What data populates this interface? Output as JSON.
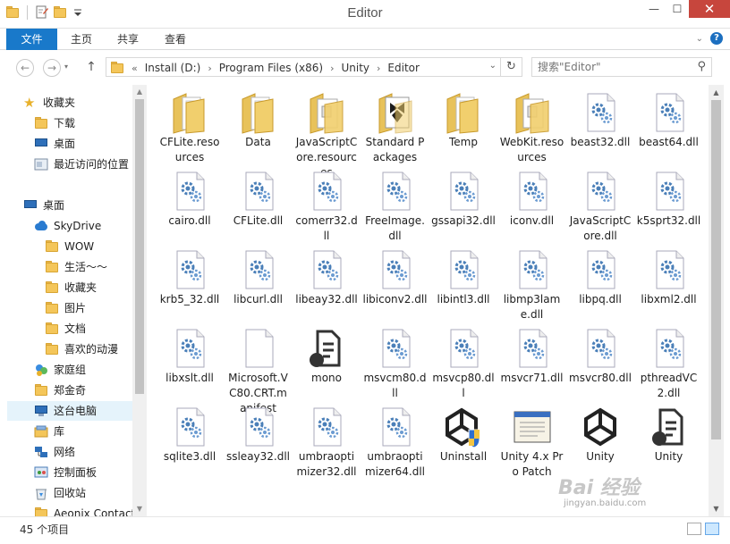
{
  "window": {
    "title": "Editor",
    "controls": {
      "minimize": "—",
      "maximize": "☐",
      "close": "✕"
    }
  },
  "ribbon": {
    "file_tab": "文件",
    "tabs": [
      "主页",
      "共享",
      "查看"
    ]
  },
  "navigation": {
    "back_icon": "arrow-left-icon",
    "forward_icon": "arrow-right-icon",
    "up_icon": "arrow-up-icon",
    "address_prefix": "«",
    "breadcrumbs": [
      "Install (D:)",
      "Program Files (x86)",
      "Unity",
      "Editor"
    ],
    "search_placeholder": "搜索\"Editor\""
  },
  "sidebar": {
    "favorites_label": "收藏夹",
    "favorites": [
      "下载",
      "桌面",
      "最近访问的位置"
    ],
    "desktop_label": "桌面",
    "skydrive_label": "SkyDrive",
    "skydrive_folders": [
      "WOW",
      "生活～～",
      "收藏夹",
      "图片",
      "文档",
      "喜欢的动漫"
    ],
    "other": [
      "家庭组",
      "郑金奇",
      "这台电脑",
      "库",
      "网络",
      "控制面板",
      "回收站",
      "Aeonix Contact"
    ],
    "selected": "这台电脑"
  },
  "files": [
    {
      "name": "CFLite.resources",
      "type": "folder-docs"
    },
    {
      "name": "Data",
      "type": "folder-docs"
    },
    {
      "name": "JavaScriptCore.resources",
      "type": "folder-page"
    },
    {
      "name": "Standard Packages",
      "type": "folder-unity"
    },
    {
      "name": "Temp",
      "type": "folder-docs"
    },
    {
      "name": "WebKit.resources",
      "type": "folder-page"
    },
    {
      "name": "beast32.dll",
      "type": "dll"
    },
    {
      "name": "beast64.dll",
      "type": "dll"
    },
    {
      "name": "cairo.dll",
      "type": "dll"
    },
    {
      "name": "CFLite.dll",
      "type": "dll"
    },
    {
      "name": "comerr32.dll",
      "type": "dll"
    },
    {
      "name": "FreeImage.dll",
      "type": "dll"
    },
    {
      "name": "gssapi32.dll",
      "type": "dll"
    },
    {
      "name": "iconv.dll",
      "type": "dll"
    },
    {
      "name": "JavaScriptCore.dll",
      "type": "dll"
    },
    {
      "name": "k5sprt32.dll",
      "type": "dll"
    },
    {
      "name": "krb5_32.dll",
      "type": "dll"
    },
    {
      "name": "libcurl.dll",
      "type": "dll"
    },
    {
      "name": "libeay32.dll",
      "type": "dll"
    },
    {
      "name": "libiconv2.dll",
      "type": "dll"
    },
    {
      "name": "libintl3.dll",
      "type": "dll"
    },
    {
      "name": "libmp3lame.dll",
      "type": "dll"
    },
    {
      "name": "libpq.dll",
      "type": "dll"
    },
    {
      "name": "libxml2.dll",
      "type": "dll"
    },
    {
      "name": "libxslt.dll",
      "type": "dll"
    },
    {
      "name": "Microsoft.VC80.CRT.manifest",
      "type": "blank"
    },
    {
      "name": "mono",
      "type": "script"
    },
    {
      "name": "msvcm80.dll",
      "type": "dll"
    },
    {
      "name": "msvcp80.dll",
      "type": "dll"
    },
    {
      "name": "msvcr71.dll",
      "type": "dll"
    },
    {
      "name": "msvcr80.dll",
      "type": "dll"
    },
    {
      "name": "pthreadVC2.dll",
      "type": "dll"
    },
    {
      "name": "sqlite3.dll",
      "type": "dll"
    },
    {
      "name": "ssleay32.dll",
      "type": "dll"
    },
    {
      "name": "umbraoptimizer32.dll",
      "type": "dll"
    },
    {
      "name": "umbraoptimizer64.dll",
      "type": "dll"
    },
    {
      "name": "Uninstall",
      "type": "unity-shield"
    },
    {
      "name": "Unity 4.x Pro Patch",
      "type": "window-app"
    },
    {
      "name": "Unity",
      "type": "unity"
    },
    {
      "name": "Unity",
      "type": "script"
    }
  ],
  "status": {
    "item_count": "45 个项目"
  },
  "watermark": {
    "brand": "Bai 经验",
    "url": "jingyan.baidu.com"
  }
}
